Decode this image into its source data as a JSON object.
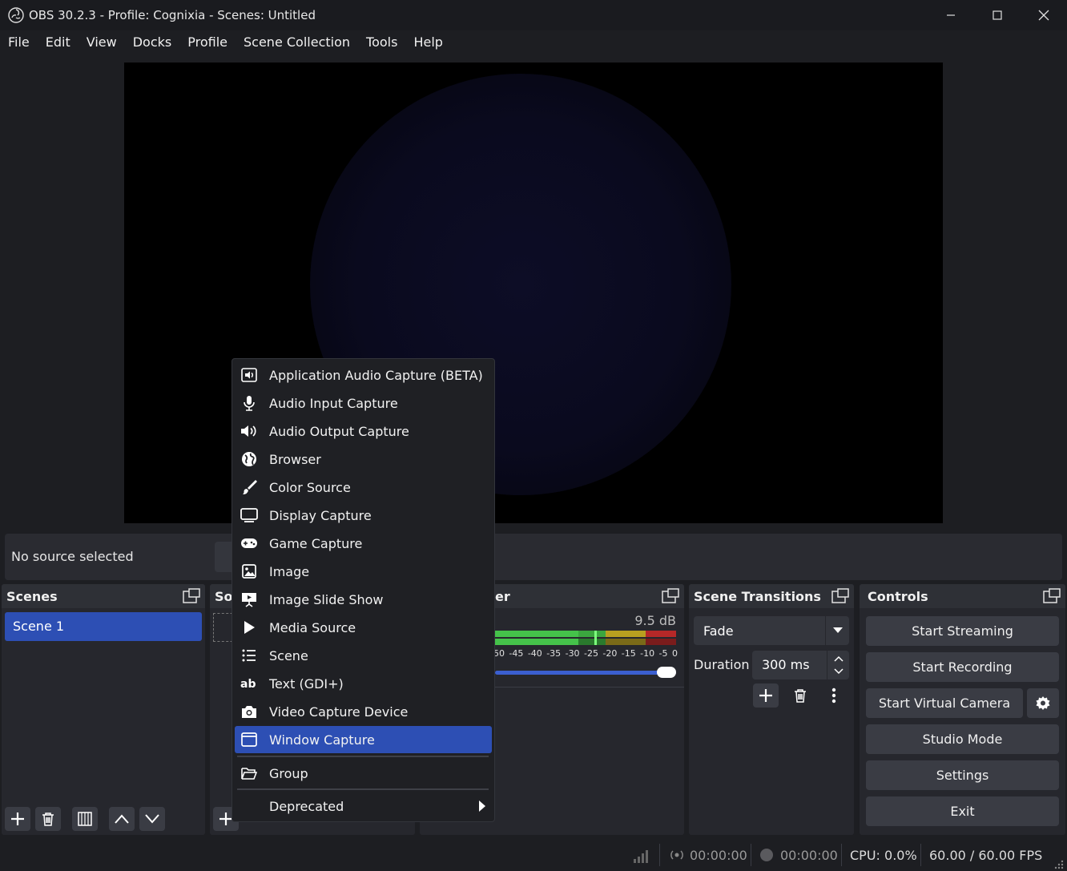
{
  "window": {
    "title": "OBS 30.2.3 - Profile: Cognixia - Scenes: Untitled"
  },
  "menubar": {
    "items": [
      "File",
      "Edit",
      "View",
      "Docks",
      "Profile",
      "Scene Collection",
      "Tools",
      "Help"
    ]
  },
  "context_bar": {
    "no_source_text": "No source selected"
  },
  "docks": {
    "scenes": {
      "title": "Scenes",
      "items": [
        {
          "label": "Scene 1",
          "selected": true
        }
      ]
    },
    "sources": {
      "title": "So"
    },
    "mixer": {
      "title": "er",
      "level": "9.5 dB",
      "scale": [
        "50",
        "-45",
        "-40",
        "-35",
        "-30",
        "-25",
        "-20",
        "-15",
        "-10",
        "-5",
        "0"
      ],
      "volume_fraction": 1.0
    },
    "transitions": {
      "title": "Scene Transitions",
      "selected": "Fade",
      "duration_label": "Duration",
      "duration_value": "300 ms"
    },
    "controls": {
      "title": "Controls",
      "buttons": {
        "start_streaming": "Start Streaming",
        "start_recording": "Start Recording",
        "start_virtual_camera": "Start Virtual Camera",
        "studio_mode": "Studio Mode",
        "settings": "Settings",
        "exit": "Exit"
      }
    }
  },
  "status": {
    "stream_time": "00:00:00",
    "record_time": "00:00:00",
    "cpu": "CPU: 0.0%",
    "fps": "60.00 / 60.00 FPS"
  },
  "add_source_menu": {
    "items": [
      {
        "label": "Application Audio Capture (BETA)",
        "icon": "app-audio-icon"
      },
      {
        "label": "Audio Input Capture",
        "icon": "microphone-icon"
      },
      {
        "label": "Audio Output Capture",
        "icon": "speaker-icon"
      },
      {
        "label": "Browser",
        "icon": "globe-icon"
      },
      {
        "label": "Color Source",
        "icon": "brush-icon"
      },
      {
        "label": "Display Capture",
        "icon": "monitor-icon"
      },
      {
        "label": "Game Capture",
        "icon": "gamepad-icon"
      },
      {
        "label": "Image",
        "icon": "image-icon"
      },
      {
        "label": "Image Slide Show",
        "icon": "slideshow-icon"
      },
      {
        "label": "Media Source",
        "icon": "play-icon"
      },
      {
        "label": "Scene",
        "icon": "list-icon"
      },
      {
        "label": "Text (GDI+)",
        "icon": "text-icon"
      },
      {
        "label": "Video Capture Device",
        "icon": "camera-icon"
      },
      {
        "label": "Window Capture",
        "icon": "window-icon",
        "selected": true
      }
    ],
    "group": {
      "label": "Group",
      "icon": "folder-icon"
    },
    "deprecated": {
      "label": "Deprecated"
    }
  },
  "colors": {
    "accent": "#2d4fb4",
    "background": "#1d1e22",
    "panel": "#26272d",
    "button": "#3a3c44"
  }
}
